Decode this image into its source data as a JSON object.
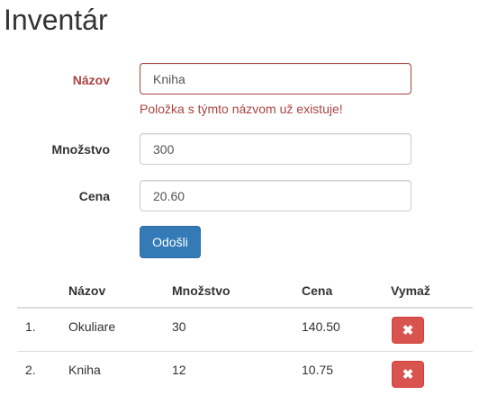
{
  "page": {
    "title": "Inventár"
  },
  "form": {
    "name": {
      "label": "Názov",
      "value": "Kniha",
      "error": "Položka s týmto názvom už existuje!"
    },
    "quantity": {
      "label": "Množstvo",
      "value": "300"
    },
    "price": {
      "label": "Cena",
      "value": "20.60"
    },
    "submit_label": "Odošli"
  },
  "table": {
    "headers": {
      "name": "Názov",
      "quantity": "Množstvo",
      "price": "Cena",
      "delete": "Vymaž"
    },
    "rows": [
      {
        "index": "1.",
        "name": "Okuliare",
        "quantity": "30",
        "price": "140.50"
      },
      {
        "index": "2.",
        "name": "Kniha",
        "quantity": "12",
        "price": "10.75"
      }
    ]
  },
  "colors": {
    "primary": "#337ab7",
    "danger": "#d9534f",
    "error_text": "#a94442"
  },
  "icons": {
    "delete": "times-icon"
  }
}
